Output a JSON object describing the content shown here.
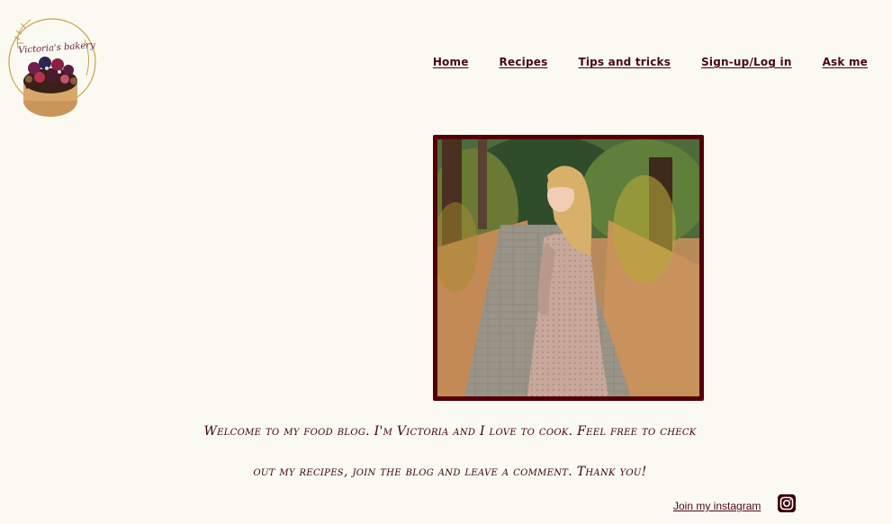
{
  "logo": {
    "title": "Victoria's bakery"
  },
  "nav": {
    "items": [
      {
        "label": "Home"
      },
      {
        "label": "Recipes"
      },
      {
        "label": "Tips and tricks"
      },
      {
        "label": "Sign-up/Log in"
      },
      {
        "label": "Ask me"
      }
    ]
  },
  "hero": {
    "welcome_line1": "Welcome to my food blog. I'm Victoria and I love to cook. Feel free to check",
    "welcome_line2": "out my recipes, join the blog and leave a comment. Thank you!"
  },
  "social": {
    "instagram_label": "Join my instagram",
    "icon": "instagram-icon"
  },
  "colors": {
    "background": "#fbfaf2",
    "accent": "#4a0610",
    "frame": "#520006"
  }
}
